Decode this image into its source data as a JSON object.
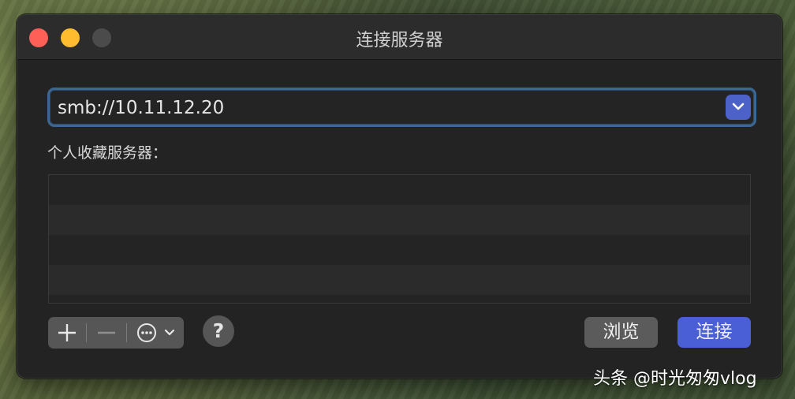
{
  "window": {
    "title": "连接服务器"
  },
  "server_address": {
    "value": "smb://10.11.12.20"
  },
  "favorites": {
    "label": "个人收藏服务器：",
    "rows": 4
  },
  "toolbar": {
    "add_label": "+",
    "remove_label": "—",
    "more_icon": "ellipsis-circle-icon",
    "help_label": "?"
  },
  "buttons": {
    "browse_label": "浏览",
    "connect_label": "连接"
  },
  "overlay": {
    "credit": "头条 @时光匆匆vlog"
  },
  "colors": {
    "accent": "#4a5fd5",
    "focus_ring": "#3c6791"
  }
}
